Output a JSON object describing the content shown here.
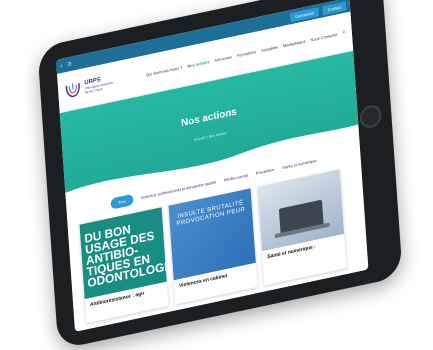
{
  "browser": {
    "nav_icons": [
      "‹",
      "≡"
    ],
    "top_buttons": [
      {
        "label": "Connexion"
      },
      {
        "label": "Contact"
      }
    ]
  },
  "site": {
    "logo": {
      "title": "URPS",
      "subtitle_line1": "Chirurgiens-Dentistes",
      "subtitle_line2": "Île-de-France"
    },
    "nav": [
      {
        "label": "Qui Sommes-Nous ?"
      },
      {
        "label": "Nos actions",
        "active": true
      },
      {
        "label": "Annonces"
      },
      {
        "label": "Formations"
      },
      {
        "label": "Actualités"
      },
      {
        "label": "Médiathèque"
      },
      {
        "label": "Nous Contacter"
      }
    ]
  },
  "hero": {
    "title": "Nos actions",
    "breadcrumb": "Accueil > Nos actions",
    "color": "#27b8a4"
  },
  "filters": [
    {
      "label": "Tout",
      "active": true
    },
    {
      "label": "Exercice professionnel et démarche qualité"
    },
    {
      "label": "Médico-social"
    },
    {
      "label": "Prévention"
    },
    {
      "label": "Santé et numérique"
    }
  ],
  "cards": [
    {
      "image_text": "DU BON USAGE DES ANTIBIO-TIQUES EN ODONTOLOGIE",
      "title": "Antibiorésistance : agir"
    },
    {
      "image_text": "INSULTE BRUTALITÉ PROVOCATION PEUR",
      "title": "Violences en cabinet"
    },
    {
      "image_text": "",
      "title": "Santé et numérique :"
    }
  ]
}
